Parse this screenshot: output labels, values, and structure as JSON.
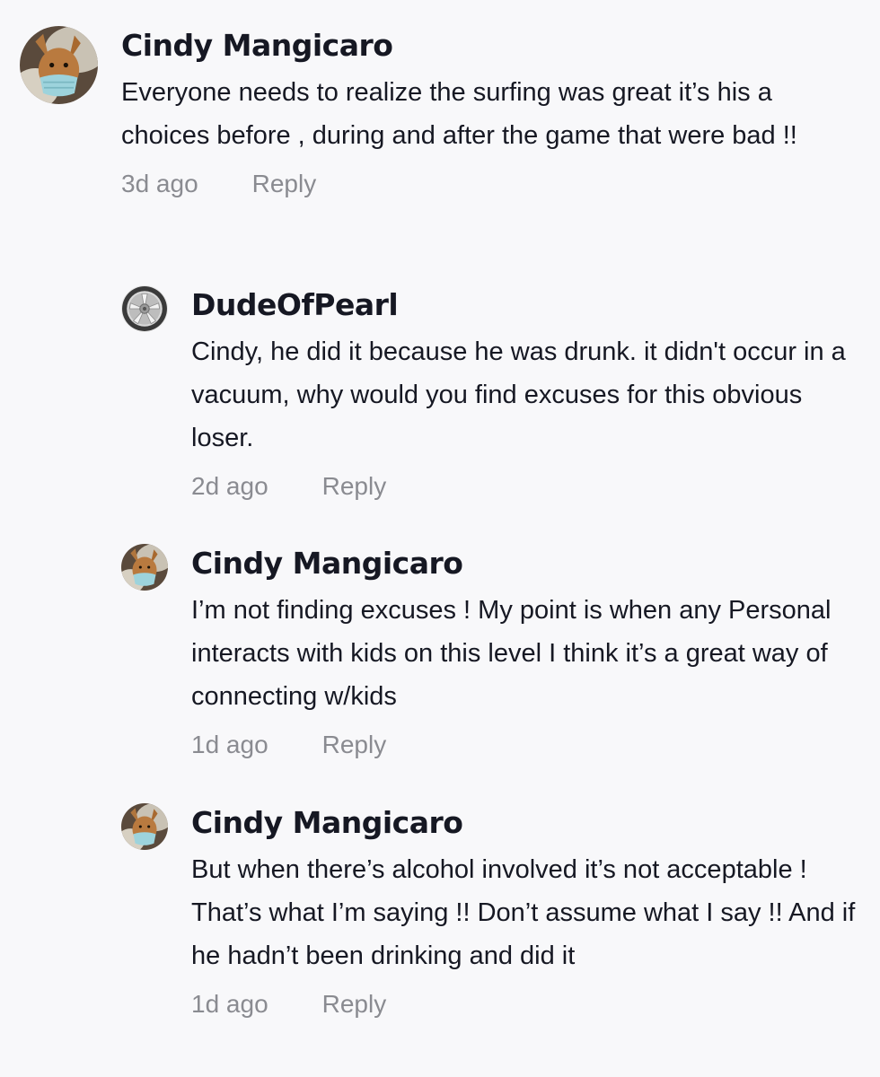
{
  "comments": [
    {
      "username": "Cindy Mangicaro",
      "avatar_icon": "dog-with-mask-avatar",
      "text": "Everyone needs to realize the surfing was great it’s his a choices before , during and after the game that were bad !!",
      "time": "3d ago",
      "reply_label": "Reply"
    },
    {
      "username": "DudeOfPearl",
      "avatar_icon": "wheel-rim-avatar",
      "text": "Cindy, he did it because he was drunk. it didn't occur in a vacuum, why would you find excuses for this obvious loser.",
      "time": "2d ago",
      "reply_label": "Reply"
    },
    {
      "username": "Cindy Mangicaro",
      "avatar_icon": "dog-with-mask-avatar",
      "text": "I’m not finding excuses ! My point is when any Personal interacts with kids on this level I think it’s a great way of connecting w/kids",
      "time": "1d ago",
      "reply_label": "Reply"
    },
    {
      "username": "Cindy Mangicaro",
      "avatar_icon": "dog-with-mask-avatar",
      "text": "But when there’s alcohol involved it’s not acceptable ! That’s what I’m saying !! Don’t assume what I say !! And if he hadn’t been drinking and did it",
      "time": "1d ago",
      "reply_label": "Reply"
    }
  ],
  "colors": {
    "background": "#f8f8fa",
    "text": "#161823",
    "meta": "#8a8b91"
  }
}
